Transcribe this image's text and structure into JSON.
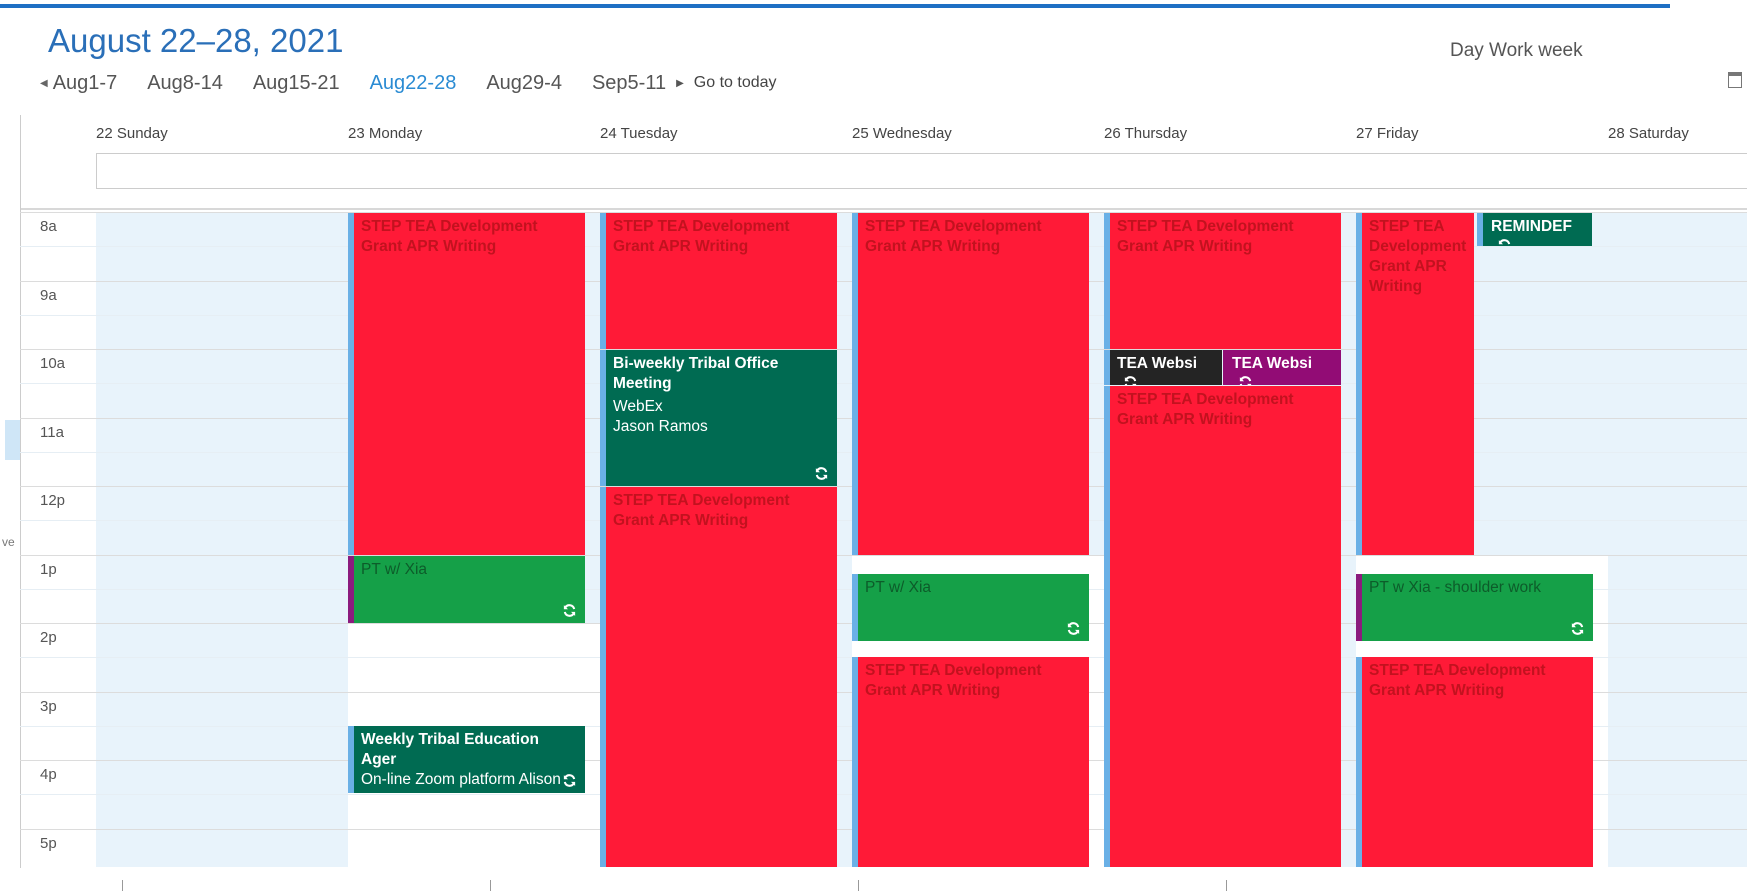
{
  "header": {
    "title": "August 22–28, 2021",
    "views": [
      "Day",
      "Work week"
    ]
  },
  "week_nav": {
    "weeks": [
      "Aug1-7",
      "Aug8-14",
      "Aug15-21",
      "Aug22-28",
      "Aug29-4",
      "Sep5-11"
    ],
    "active_index": 3,
    "go_to_today": "Go to today"
  },
  "days": [
    "22 Sunday",
    "23 Monday",
    "24 Tuesday",
    "25 Wednesday",
    "26 Thursday",
    "27 Friday",
    "28 Saturday"
  ],
  "hours": [
    "8a",
    "9a",
    "10a",
    "11a",
    "12p",
    "1p",
    "2p",
    "3p",
    "4p",
    "5p"
  ],
  "colors": {
    "red": "#ff1a37",
    "green": "#15a048",
    "teal": "#006b52",
    "dark": "#242424",
    "purple": "#920c75",
    "accent": "#2a6fb8"
  },
  "events": {
    "mon_step": {
      "line1": "STEP TEA Development",
      "line2": "Grant APR Writing"
    },
    "mon_pt": {
      "line1": "PT w/ Xia"
    },
    "mon_weekly": {
      "line1": "Weekly Tribal Education Ager",
      "line2": "On-line Zoom platform Alison"
    },
    "tue_step_am": {
      "line1": "STEP TEA Development",
      "line2": "Grant APR Writing"
    },
    "tue_biweekly": {
      "line1": "Bi-weekly Tribal Office",
      "line2": "Meeting",
      "line3": "WebEx",
      "line4": "Jason Ramos"
    },
    "tue_step_pm": {
      "line1": "STEP TEA Development",
      "line2": "Grant APR Writing"
    },
    "wed_step_am": {
      "line1": "STEP TEA Development",
      "line2": "Grant APR Writing"
    },
    "wed_pt": {
      "line1": "PT w/ Xia"
    },
    "wed_step_pm": {
      "line1": "STEP TEA Development",
      "line2": "Grant APR Writing"
    },
    "thu_step_am": {
      "line1": "STEP TEA Development",
      "line2": "Grant APR Writing"
    },
    "thu_tea_dark": {
      "line1": "TEA Websi"
    },
    "thu_tea_purple": {
      "line1": "TEA Websi"
    },
    "thu_step_pm": {
      "line1": "STEP TEA Development",
      "line2": "Grant APR Writing"
    },
    "fri_step_am": {
      "line1": "STEP TEA",
      "line2": "Development",
      "line3": "Grant APR",
      "line4": "Writing"
    },
    "fri_reminder": {
      "line1": "REMINDEF"
    },
    "fri_pt": {
      "line1": "PT w Xia - shoulder work"
    },
    "fri_step_pm": {
      "line1": "STEP TEA Development",
      "line2": "Grant APR Writing"
    }
  },
  "sidebar_fragment": "ve"
}
